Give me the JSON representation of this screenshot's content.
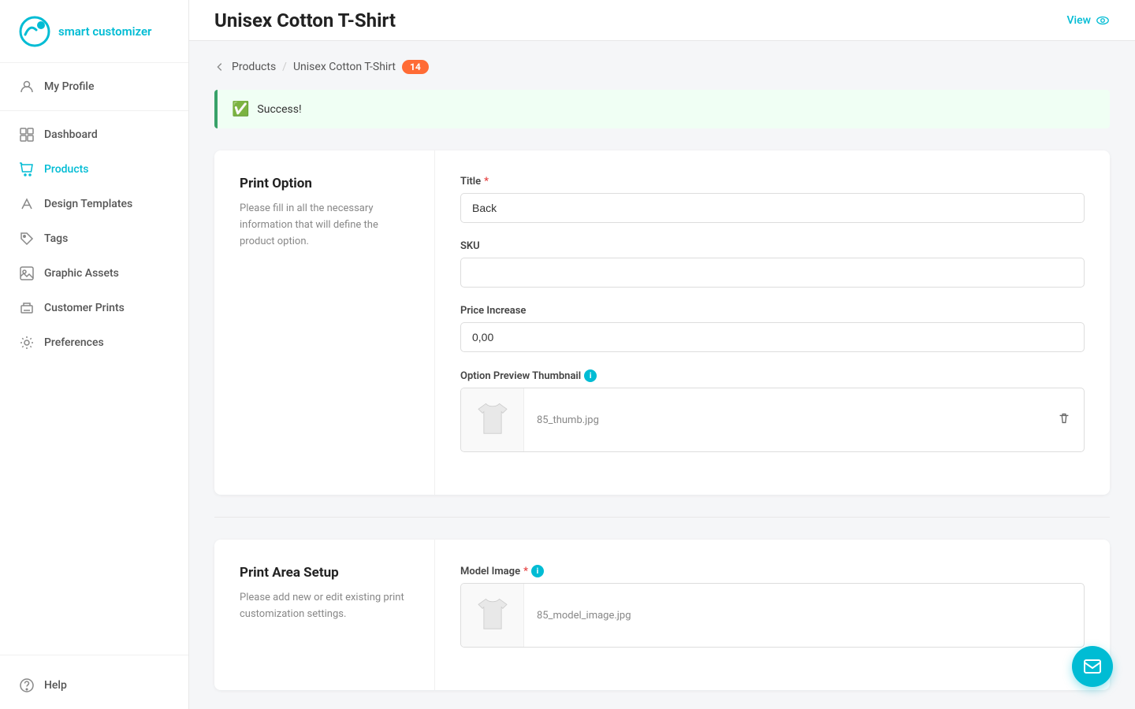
{
  "app": {
    "logo_text": "smart customizer"
  },
  "sidebar": {
    "items": [
      {
        "id": "my-profile",
        "label": "My Profile",
        "icon": "user-icon"
      },
      {
        "id": "dashboard",
        "label": "Dashboard",
        "icon": "dashboard-icon"
      },
      {
        "id": "products",
        "label": "Products",
        "icon": "products-icon",
        "active": true
      },
      {
        "id": "design-templates",
        "label": "Design Templates",
        "icon": "design-icon"
      },
      {
        "id": "tags",
        "label": "Tags",
        "icon": "tags-icon"
      },
      {
        "id": "graphic-assets",
        "label": "Graphic Assets",
        "icon": "graphic-icon"
      },
      {
        "id": "customer-prints",
        "label": "Customer Prints",
        "icon": "prints-icon"
      },
      {
        "id": "preferences",
        "label": "Preferences",
        "icon": "prefs-icon"
      }
    ],
    "bottom_items": [
      {
        "id": "help",
        "label": "Help",
        "icon": "help-icon"
      }
    ]
  },
  "header": {
    "page_title": "Unisex Cotton T-Shirt",
    "view_label": "View"
  },
  "breadcrumb": {
    "back_label": "Products",
    "current_label": "Unisex Cotton T-Shirt",
    "badge": "14"
  },
  "alert": {
    "message": "Success!"
  },
  "print_option_section": {
    "title": "Print Option",
    "description": "Please fill in all the necessary information that will define the product option.",
    "title_label": "Title",
    "title_required": "*",
    "title_value": "Back",
    "sku_label": "SKU",
    "sku_value": "",
    "price_increase_label": "Price Increase",
    "price_increase_value": "0,00",
    "thumbnail_label": "Option Preview Thumbnail",
    "thumbnail_filename": "85_thumb.jpg"
  },
  "print_area_section": {
    "title": "Print Area Setup",
    "description": "Please add new or edit existing print customization settings.",
    "model_image_label": "Model Image",
    "model_image_required": "*",
    "model_image_filename": "85_model_image.jpg"
  }
}
